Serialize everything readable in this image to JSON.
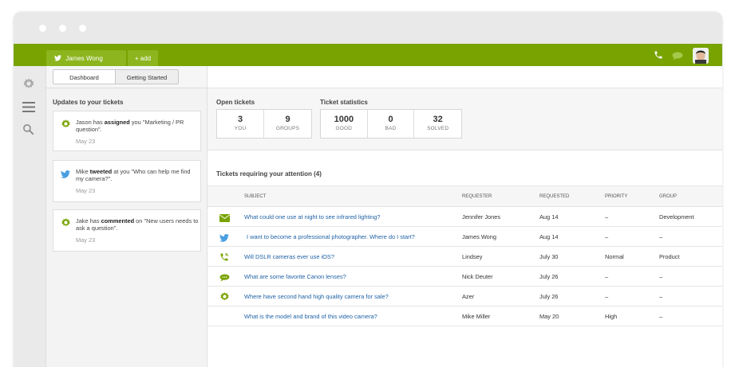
{
  "topbar": {
    "user_tab": "James Wong",
    "add_tab": "+ add",
    "brand_color": "#78a300"
  },
  "subtabs": [
    "Dashboard",
    "Getting Started"
  ],
  "updates": {
    "title": "Updates to your tickets",
    "items": [
      {
        "icon": "zendesk-gear-icon",
        "actor": "Jason has ",
        "action": "assigned",
        "rest": " you \"Marketing / PR question\".",
        "date": "May 23"
      },
      {
        "icon": "twitter-bird-icon",
        "actor": "Mike ",
        "action": "tweeted",
        "rest": " at you \"Who can help me find my camera?\".",
        "date": "May 23"
      },
      {
        "icon": "zendesk-gear-icon",
        "actor": "Jake has ",
        "action": "commented",
        "rest": " on \"New users needs to ask a question\".",
        "date": "May 23"
      }
    ]
  },
  "open_tickets": {
    "title": "Open tickets",
    "cells": [
      {
        "value": "3",
        "label": "YOU"
      },
      {
        "value": "9",
        "label": "GROUPS"
      }
    ]
  },
  "ticket_stats": {
    "title": "Ticket statistics",
    "cells": [
      {
        "value": "1000",
        "label": "GOOD"
      },
      {
        "value": "0",
        "label": "BAD"
      },
      {
        "value": "32",
        "label": "SOLVED"
      }
    ]
  },
  "attention": {
    "title": "Tickets requiring your attention (4)",
    "headers": [
      "SUBJECT",
      "REQUESTER",
      "REQUESTED",
      "PRIORITY",
      "GROUP"
    ],
    "rows": [
      {
        "icon": "email-icon",
        "subject": "What could one use at night to see infrared lighting?",
        "requester": "Jennifer Jones",
        "requested": "Aug 14",
        "priority": "–",
        "group": "Development"
      },
      {
        "icon": "twitter-bird-icon",
        "subject": "I want to become a professional photographer. Where do I start?",
        "requester": "James Wong",
        "requested": "Aug 14",
        "priority": "–",
        "group": "–"
      },
      {
        "icon": "phone-icon",
        "subject": "Will DSLR cameras ever use iOS?",
        "requester": "Lindsey",
        "requested": "July 30",
        "priority": "Normal",
        "group": "Product"
      },
      {
        "icon": "chat-icon",
        "subject": "What are some favorite Canon lenses?",
        "requester": "Nick Deuter",
        "requested": "July 26",
        "priority": "–",
        "group": "–"
      },
      {
        "icon": "zendesk-gear-icon",
        "subject": "Where have second hand high quality camera for sale?",
        "requester": "Azer",
        "requested": "July 26",
        "priority": "–",
        "group": "–"
      },
      {
        "icon": "",
        "subject": "What is the model and brand of this video camera?",
        "requester": "Mike Miller",
        "requested": "May 20",
        "priority": "High",
        "group": "–"
      }
    ]
  }
}
